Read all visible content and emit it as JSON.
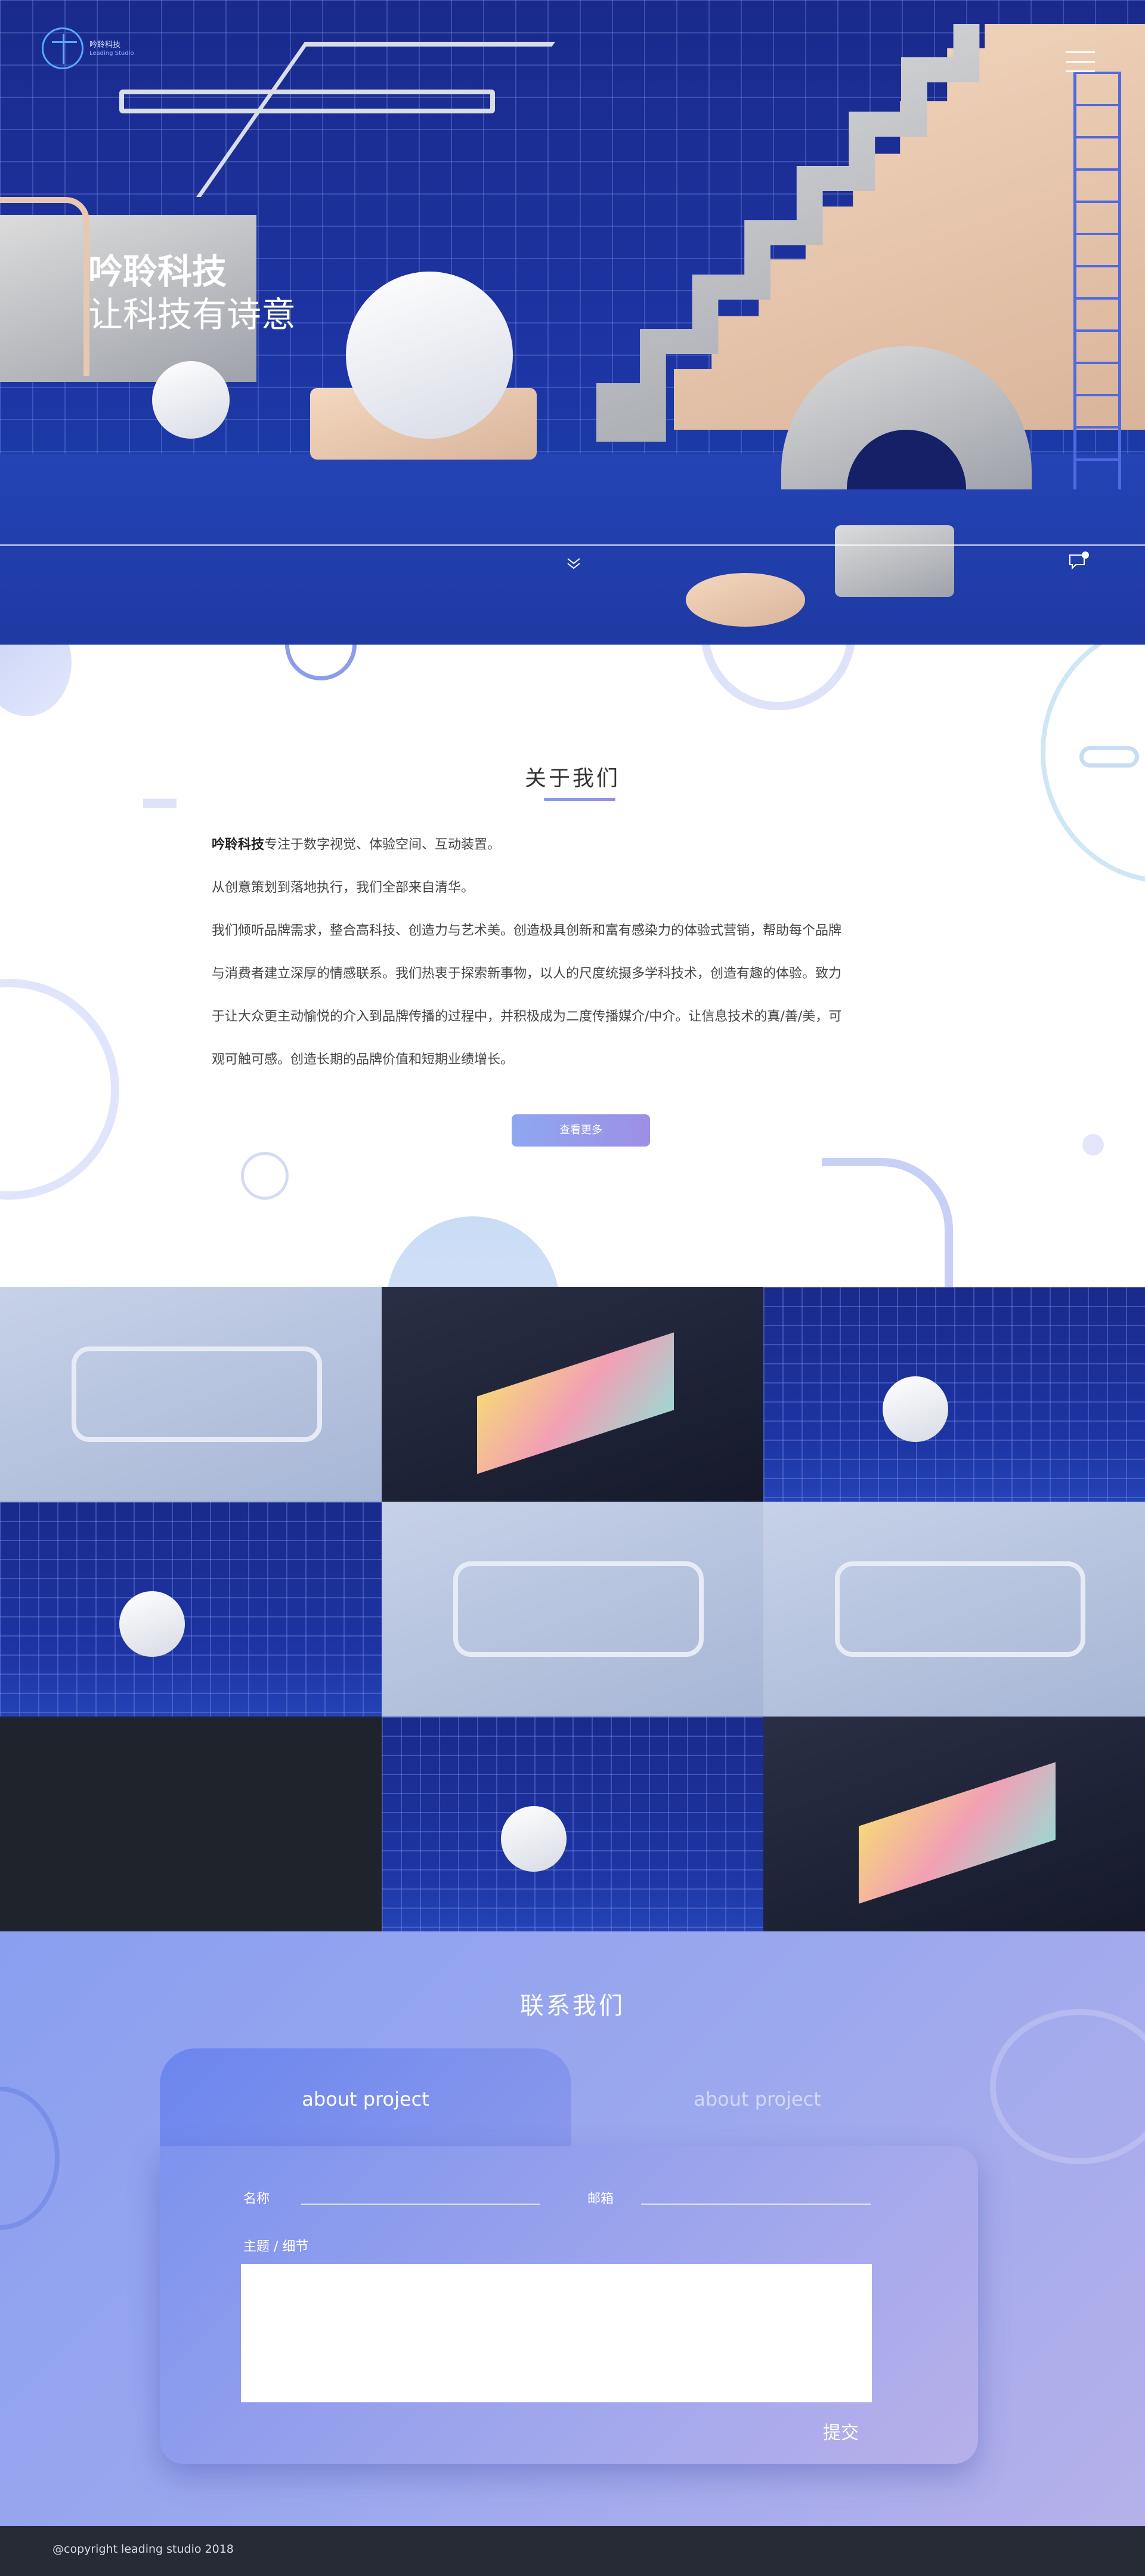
{
  "logo": {
    "name": "吟聆科技",
    "subtitle": "Leading Studio"
  },
  "hero": {
    "title": "吟聆科技",
    "subtitle": "让科技有诗意"
  },
  "about": {
    "title": "关于我们",
    "brand": "吟聆科技",
    "line1_rest": "专注于数字视觉、体验空间、互动装置。",
    "line2": "从创意策划到落地执行，我们全部来自清华。",
    "line3": " 我们倾听品牌需求，整合高科技、创造力与艺术美。创造极具创新和富有感染力的体验式营销，帮助每个品牌",
    "line4": "与消费者建立深厚的情感联系。我们热衷于探索新事物，以人的尺度统摄多学科技术，创造有趣的体验。致力",
    "line5": "于让大众更主动愉悦的介入到品牌传播的过程中，并积极成为二度传播媒介/中介。让信息技术的真/善/美，可",
    "line6": "观可触可感。创造长期的品牌价值和短期业绩增长。",
    "more_label": "查看更多"
  },
  "gallery": {
    "tiles": [
      "machine",
      "dark",
      "stairs",
      "stairs",
      "machine",
      "machine",
      "empty",
      "stairs",
      "dark"
    ]
  },
  "contact": {
    "title": "联系我们",
    "tab_active": "about project",
    "tab_inactive": "about project",
    "name_label": "名称",
    "email_label": "邮箱",
    "subject_label": "主题 / 细节",
    "submit_label": "提交"
  },
  "footer": {
    "copyright": "@copyright leading studio 2018"
  },
  "colors": {
    "hero_blue": "#1d34a3",
    "accent": "#8ea7f0",
    "footer": "#262b35"
  },
  "icons": [
    "menu-icon",
    "chevron-down-icon",
    "chat-icon"
  ]
}
